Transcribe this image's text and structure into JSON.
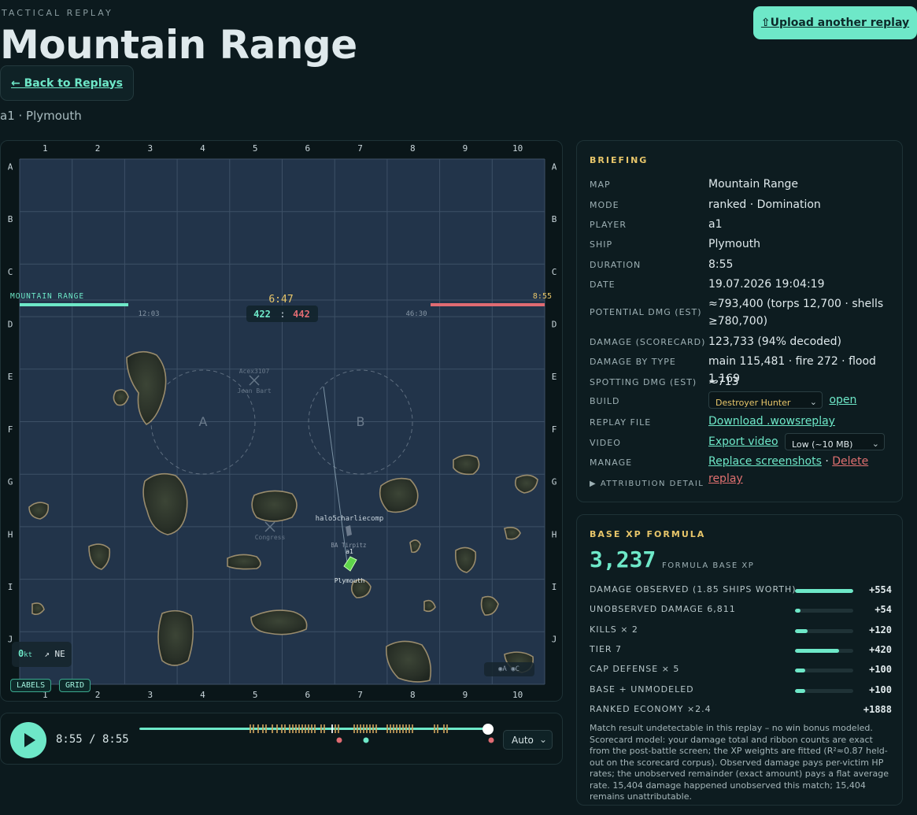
{
  "header": {
    "eyebrow": "TACTICAL REPLAY",
    "title": "Mountain Range",
    "back_label": "← Back to Replays",
    "upload_label": "⇧Upload another replay",
    "subtitle": "a1 · Plymouth"
  },
  "map": {
    "name": "MOUNTAIN RANGE",
    "end_time": "8:55",
    "clock": "6:47",
    "score_green": "422",
    "score_sep": ":",
    "score_red": "442",
    "green_timer": "12:03",
    "red_timer": "46:30",
    "col_labels": [
      "1",
      "2",
      "3",
      "4",
      "5",
      "6",
      "7",
      "8",
      "9",
      "10"
    ],
    "row_labels": [
      "A",
      "B",
      "C",
      "D",
      "E",
      "F",
      "G",
      "H",
      "I",
      "J"
    ],
    "caps": [
      {
        "label": "A"
      },
      {
        "label": "B"
      }
    ],
    "ships": {
      "player": "a1",
      "player_ship": "Plymouth",
      "nearby": "BA Tirpitz",
      "enemy": "halo5charliecomp",
      "dead1_name": "Acex3107",
      "dead1_ship": "Jean Bart",
      "dead2_ship": "Congress"
    },
    "speed": "0",
    "speed_unit": "kt",
    "heading": "↗ NE",
    "buttons": [
      "LABELS",
      "GRID"
    ],
    "legend": "◉A  ◉C",
    "colors": {
      "green": "#6ee8c8",
      "red": "#e06b72",
      "accent": "#e8c66a"
    }
  },
  "timeline": {
    "time": "8:55 / 8:55",
    "speed_value": "Auto",
    "progress": 1.0
  },
  "briefing": {
    "title": "BRIEFING",
    "rows": [
      {
        "label": "MAP",
        "value": "Mountain Range"
      },
      {
        "label": "MODE",
        "value": "ranked · Domination"
      },
      {
        "label": "PLAYER",
        "value": "a1"
      },
      {
        "label": "SHIP",
        "value": "Plymouth"
      },
      {
        "label": "DURATION",
        "value": "8:55"
      },
      {
        "label": "DATE",
        "value": "19.07.2026 19:04:19"
      },
      {
        "label": "POTENTIAL DMG (EST)",
        "value": "≈793,400 (torps 12,700 · shells ≥780,700)"
      },
      {
        "label": "DAMAGE (SCORECARD)",
        "value": "123,733 (94% decoded)"
      },
      {
        "label": "DAMAGE BY TYPE",
        "value": "main 115,481 · fire 272 · flood 1,169"
      },
      {
        "label": "SPOTTING DMG (EST)",
        "value": "≈713"
      }
    ],
    "build_label": "BUILD",
    "build_value": "Destroyer Hunter",
    "build_link": "open",
    "replay_label": "REPLAY FILE",
    "replay_link": "Download .wowsreplay",
    "video_label": "VIDEO",
    "video_link": "Export video",
    "video_quality": "Low (~10 MB)",
    "manage_label": "MANAGE",
    "manage_replace": "Replace screenshots",
    "manage_sep": " · ",
    "manage_delete": "Delete replay",
    "attribution": "▶ ATTRIBUTION DETAIL"
  },
  "xp": {
    "title": "BASE XP FORMULA",
    "total": "3,237",
    "total_label": "FORMULA BASE XP",
    "rows": [
      {
        "label": "DAMAGE OBSERVED (1.85 SHIPS WORTH)",
        "value": "+554",
        "fill": 1.0
      },
      {
        "label": "UNOBSERVED DAMAGE 6,811",
        "value": "+54",
        "fill": 0.1
      },
      {
        "label": "KILLS × 2",
        "value": "+120",
        "fill": 0.22
      },
      {
        "label": "TIER 7",
        "value": "+420",
        "fill": 0.76
      },
      {
        "label": "CAP DEFENSE × 5",
        "value": "+100",
        "fill": 0.18
      },
      {
        "label": "BASE + UNMODELED",
        "value": "+100",
        "fill": 0.18
      },
      {
        "label": "RANKED ECONOMY ×2.4",
        "value": "+1888",
        "fill": null
      }
    ],
    "note": "Match result undetectable in this replay – no win bonus modeled. Scorecard model: your damage total and ribbon counts are exact from the post-battle screen; the XP weights are fitted (R²≈0.87 held-out on the scorecard corpus). Observed damage pays per-victim HP rates; the unobserved remainder (exact amount) pays a flat average rate. 15,404 damage happened unobserved this match; 15,404 remains unattributable."
  }
}
